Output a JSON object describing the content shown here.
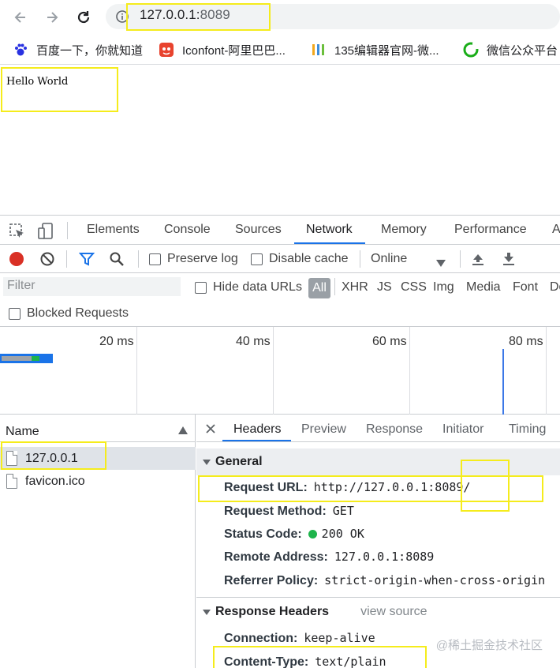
{
  "browser": {
    "url_host": "127.0.0.1:",
    "url_port": "8089",
    "bookmarks": [
      {
        "label": "百度一下，你就知道",
        "icon": "baidu-paw-icon"
      },
      {
        "label": "Iconfont-阿里巴巴...",
        "icon": "iconfont-icon"
      },
      {
        "label": "135编辑器官网-微...",
        "icon": "135-editor-icon"
      },
      {
        "label": "微信公众平台",
        "icon": "wechat-icon"
      }
    ]
  },
  "page": {
    "body_text": "Hello World"
  },
  "devtools": {
    "tabs": [
      "Elements",
      "Console",
      "Sources",
      "Network",
      "Memory",
      "Performance",
      "A"
    ],
    "active_tab": "Network",
    "toolbar": {
      "preserve_log": "Preserve log",
      "disable_cache": "Disable cache",
      "throttle": "Online"
    },
    "filter": {
      "placeholder": "Filter",
      "hide_data_urls": "Hide data URLs",
      "types": [
        "All",
        "XHR",
        "JS",
        "CSS",
        "Img",
        "Media",
        "Font",
        "Do"
      ],
      "blocked_requests": "Blocked Requests"
    },
    "timeline_ticks": [
      "20 ms",
      "40 ms",
      "60 ms",
      "80 ms"
    ],
    "name_column": "Name",
    "requests": [
      {
        "name": "127.0.0.1",
        "selected": true
      },
      {
        "name": "favicon.ico",
        "selected": false
      }
    ],
    "detail_tabs": [
      "Headers",
      "Preview",
      "Response",
      "Initiator",
      "Timing"
    ],
    "general": {
      "title": "General",
      "fields": [
        {
          "key": "Request URL:",
          "value": "http://127.0.0.1:8089/"
        },
        {
          "key": "Request Method:",
          "value": "GET"
        },
        {
          "key": "Status Code:",
          "value": "200 OK"
        },
        {
          "key": "Remote Address:",
          "value": "127.0.0.1:8089"
        },
        {
          "key": "Referrer Policy:",
          "value": "strict-origin-when-cross-origin"
        }
      ]
    },
    "response_headers": {
      "title": "Response Headers",
      "view_source": "view source",
      "fields": [
        {
          "key": "Connection:",
          "value": "keep-alive"
        },
        {
          "key": "Content-Type:",
          "value": "text/plain"
        }
      ]
    }
  },
  "watermark": "@稀土掘金技术社区",
  "colors": {
    "highlight": "#f5ec1c",
    "accent": "#1a73e8",
    "record": "#d93025",
    "status_ok": "#1eb44b"
  }
}
